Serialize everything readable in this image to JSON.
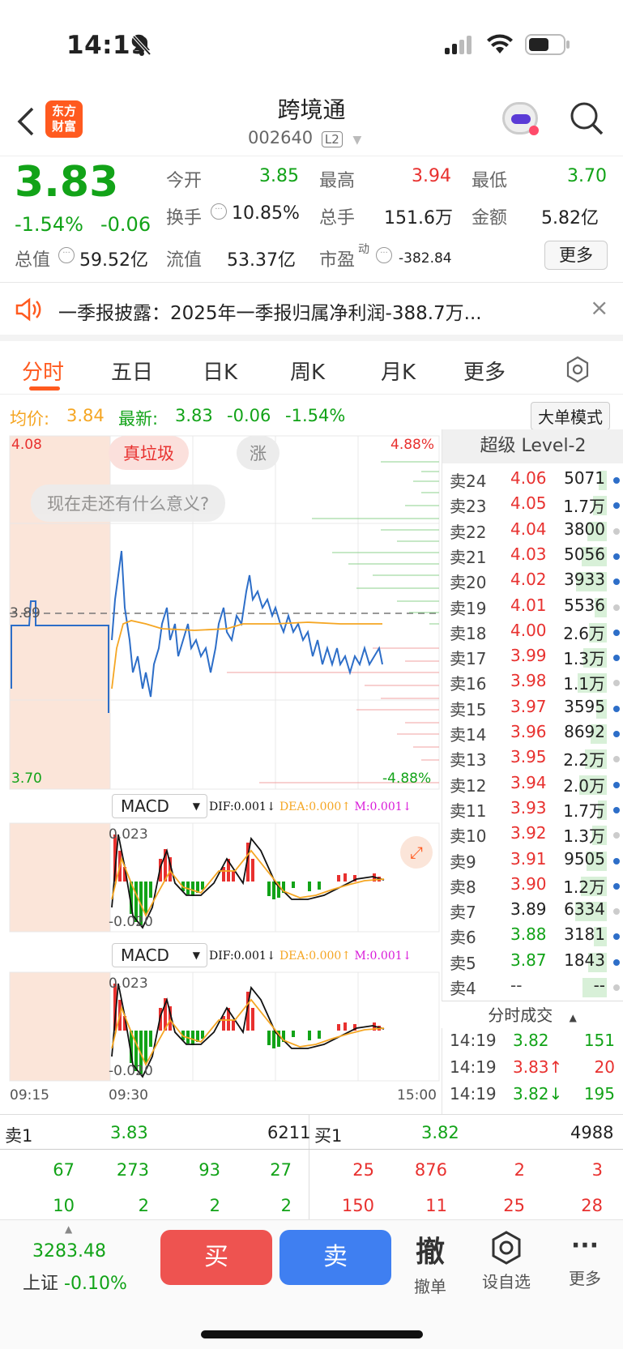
{
  "status_bar": {
    "time": "14:19"
  },
  "header": {
    "title": "跨境通",
    "code": "002640",
    "level_badge": "L2",
    "logo_line1": "东方",
    "logo_line2": "财富"
  },
  "quote": {
    "price": "3.83",
    "change_pct": "-1.54%",
    "change": "-0.06",
    "open_label": "今开",
    "open": "3.85",
    "high_label": "最高",
    "high": "3.94",
    "low_label": "最低",
    "low": "3.70",
    "turnover_label": "换手",
    "turnover": "10.85%",
    "volume_label": "总手",
    "volume": "151.6万",
    "amount_label": "金额",
    "amount": "5.82亿",
    "mktcap_label": "总值",
    "mktcap": "59.52亿",
    "float_label": "流值",
    "float": "53.37亿",
    "pe_label": "市盈",
    "pe_sup": "动",
    "pe": "-382.84",
    "more_label": "更多"
  },
  "notice": {
    "text": "一季报披露：2025年一季报归属净利润-388.7万..."
  },
  "tabs": [
    {
      "label": "分时"
    },
    {
      "label": "五日"
    },
    {
      "label": "日K"
    },
    {
      "label": "周K"
    },
    {
      "label": "月K"
    },
    {
      "label": "更多"
    }
  ],
  "info": {
    "avg_label": "均价:",
    "avg": "3.84",
    "latest_label": "最新:",
    "latest": "3.83",
    "chg": "-0.06",
    "chg_pct": "-1.54%",
    "mode_label": "大单模式"
  },
  "chart": {
    "y_max": "4.08",
    "y_min": "3.70",
    "y_mid": "3.89",
    "pct_max": "4.88%",
    "pct_min": "-4.88%",
    "comment1": "真垃圾",
    "comment2": "涨",
    "comment3": "现在走还有什么意义?",
    "time_start": "09:15",
    "time_open": "09:30",
    "time_end": "15:00",
    "macd_label": "MACD",
    "dif": "DIF:0.001",
    "dea": "DEA:0.000",
    "m": "M:0.001",
    "macd_top": "0.023",
    "macd_bot": "-0.020"
  },
  "chart_data": {
    "type": "line",
    "title": "",
    "series": [
      {
        "name": "",
        "values": [
          3.89,
          3.92,
          3.85,
          3.8,
          3.86,
          3.88,
          3.84,
          3.87,
          3.85,
          3.86,
          3.9,
          3.93,
          3.9,
          3.88,
          3.87,
          3.85,
          3.84,
          3.85,
          3.84,
          3.83
        ]
      },
      {
        "name": "均价",
        "values": [
          3.85,
          3.85,
          3.85,
          3.85,
          3.85,
          3.85,
          3.84,
          3.84,
          3.84,
          3.84,
          3.84,
          3.85,
          3.85,
          3.85,
          3.85,
          3.84,
          3.84,
          3.84,
          3.84,
          3.84
        ]
      }
    ],
    "ylim": [
      3.7,
      4.08
    ]
  },
  "level2": {
    "title": "超级 Level-2",
    "asks": [
      {
        "label": "卖24",
        "price": "4.06",
        "vol": "5071"
      },
      {
        "label": "卖23",
        "price": "4.05",
        "vol": "1.7万"
      },
      {
        "label": "卖22",
        "price": "4.04",
        "vol": "3800"
      },
      {
        "label": "卖21",
        "price": "4.03",
        "vol": "5056"
      },
      {
        "label": "卖20",
        "price": "4.02",
        "vol": "3933"
      },
      {
        "label": "卖19",
        "price": "4.01",
        "vol": "5536"
      },
      {
        "label": "卖18",
        "price": "4.00",
        "vol": "2.6万"
      },
      {
        "label": "卖17",
        "price": "3.99",
        "vol": "1.3万"
      },
      {
        "label": "卖16",
        "price": "3.98",
        "vol": "1.1万"
      },
      {
        "label": "卖15",
        "price": "3.97",
        "vol": "3595"
      },
      {
        "label": "卖14",
        "price": "3.96",
        "vol": "8692"
      },
      {
        "label": "卖13",
        "price": "3.95",
        "vol": "2.2万"
      },
      {
        "label": "卖12",
        "price": "3.94",
        "vol": "2.0万"
      },
      {
        "label": "卖11",
        "price": "3.93",
        "vol": "1.7万"
      },
      {
        "label": "卖10",
        "price": "3.92",
        "vol": "1.3万"
      },
      {
        "label": "卖9",
        "price": "3.91",
        "vol": "9505"
      },
      {
        "label": "卖8",
        "price": "3.90",
        "vol": "1.2万"
      },
      {
        "label": "卖7",
        "price": "3.89",
        "vol": "6334"
      },
      {
        "label": "卖6",
        "price": "3.88",
        "vol": "3181"
      },
      {
        "label": "卖5",
        "price": "3.87",
        "vol": "1843"
      },
      {
        "label": "卖4",
        "price": "--",
        "vol": "--"
      }
    ],
    "ticks_title": "分时成交",
    "ticks": [
      {
        "time": "14:19",
        "price": "3.82",
        "vol": "151",
        "arrow": ""
      },
      {
        "time": "14:19",
        "price": "3.83↑",
        "vol": "20",
        "arrow": ""
      },
      {
        "time": "14:19",
        "price": "3.82↓",
        "vol": "195",
        "arrow": ""
      }
    ]
  },
  "bottom": {
    "sell_label": "卖1",
    "sell_price": "3.83",
    "sell_vol": "6211",
    "buy_label": "买1",
    "buy_price": "3.82",
    "buy_vol": "4988",
    "left_row1": [
      "67",
      "273",
      "93",
      "27"
    ],
    "left_row2": [
      "10",
      "2",
      "2",
      "2"
    ],
    "right_row1": [
      "25",
      "876",
      "2",
      "3"
    ],
    "right_row2": [
      "150",
      "11",
      "25",
      "28"
    ]
  },
  "tradebar": {
    "index_value": "3283.48",
    "index_name": "上证",
    "index_chg": "-0.10%",
    "buy": "买",
    "sell": "卖",
    "cancel_icon": "撤",
    "cancel": "撤单",
    "watch": "设自选",
    "more": "更多"
  }
}
